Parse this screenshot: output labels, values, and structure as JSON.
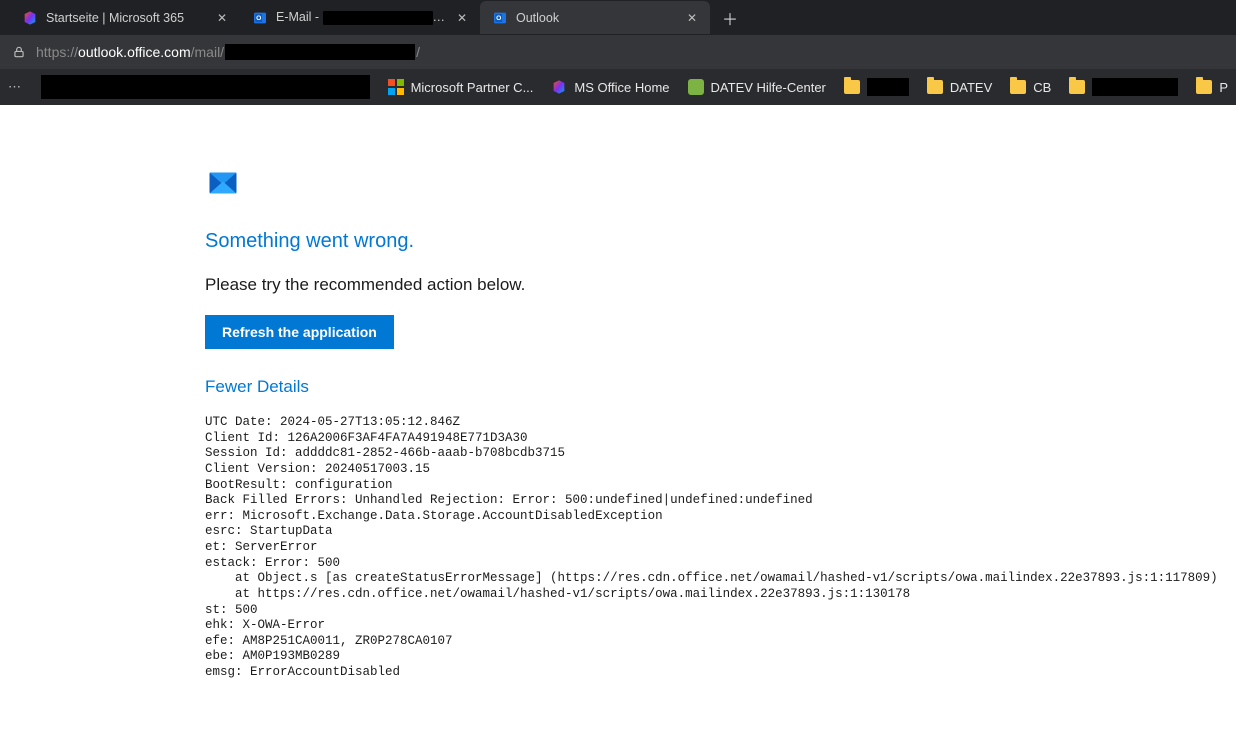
{
  "tabs": [
    {
      "title": "Startseite | Microsoft 365",
      "icon": "ms365"
    },
    {
      "title_prefix": "E-Mail - ",
      "title_suffix": "Ou",
      "icon": "outlook",
      "redacted": true
    },
    {
      "title": "Outlook",
      "icon": "outlook",
      "active": true
    }
  ],
  "address_bar": {
    "scheme": "https://",
    "host": "outlook.office.com",
    "path_before": "/mail/",
    "path_after": "/"
  },
  "bookmarks": [
    {
      "type": "link",
      "label": "Microsoft Partner C...",
      "icon": "msgrid"
    },
    {
      "type": "link",
      "label": "MS Office Home",
      "icon": "ms365"
    },
    {
      "type": "link",
      "label": "DATEV Hilfe-Center",
      "icon": "datev"
    },
    {
      "type": "folder",
      "label_redacted": true
    },
    {
      "type": "folder",
      "label": "DATEV"
    },
    {
      "type": "folder",
      "label": "CB"
    },
    {
      "type": "folder",
      "label_redacted": true,
      "wide": true
    },
    {
      "type": "folder",
      "label": "P"
    }
  ],
  "error": {
    "title": "Something went wrong.",
    "subtitle": "Please try the recommended action below.",
    "refresh_label": "Refresh the application",
    "toggle_label": "Fewer Details",
    "details": "UTC Date: 2024-05-27T13:05:12.846Z\nClient Id: 126A2006F3AF4FA7A491948E771D3A30\nSession Id: addddc81-2852-466b-aaab-b708bcdb3715\nClient Version: 20240517003.15\nBootResult: configuration\nBack Filled Errors: Unhandled Rejection: Error: 500:undefined|undefined:undefined\nerr: Microsoft.Exchange.Data.Storage.AccountDisabledException\nesrc: StartupData\net: ServerError\nestack: Error: 500\n    at Object.s [as createStatusErrorMessage] (https://res.cdn.office.net/owamail/hashed-v1/scripts/owa.mailindex.22e37893.js:1:117809)\n    at https://res.cdn.office.net/owamail/hashed-v1/scripts/owa.mailindex.22e37893.js:1:130178\nst: 500\nehk: X-OWA-Error\nefe: AM8P251CA0011, ZR0P278CA0107\nebe: AM0P193MB0289\nemsg: ErrorAccountDisabled"
  }
}
